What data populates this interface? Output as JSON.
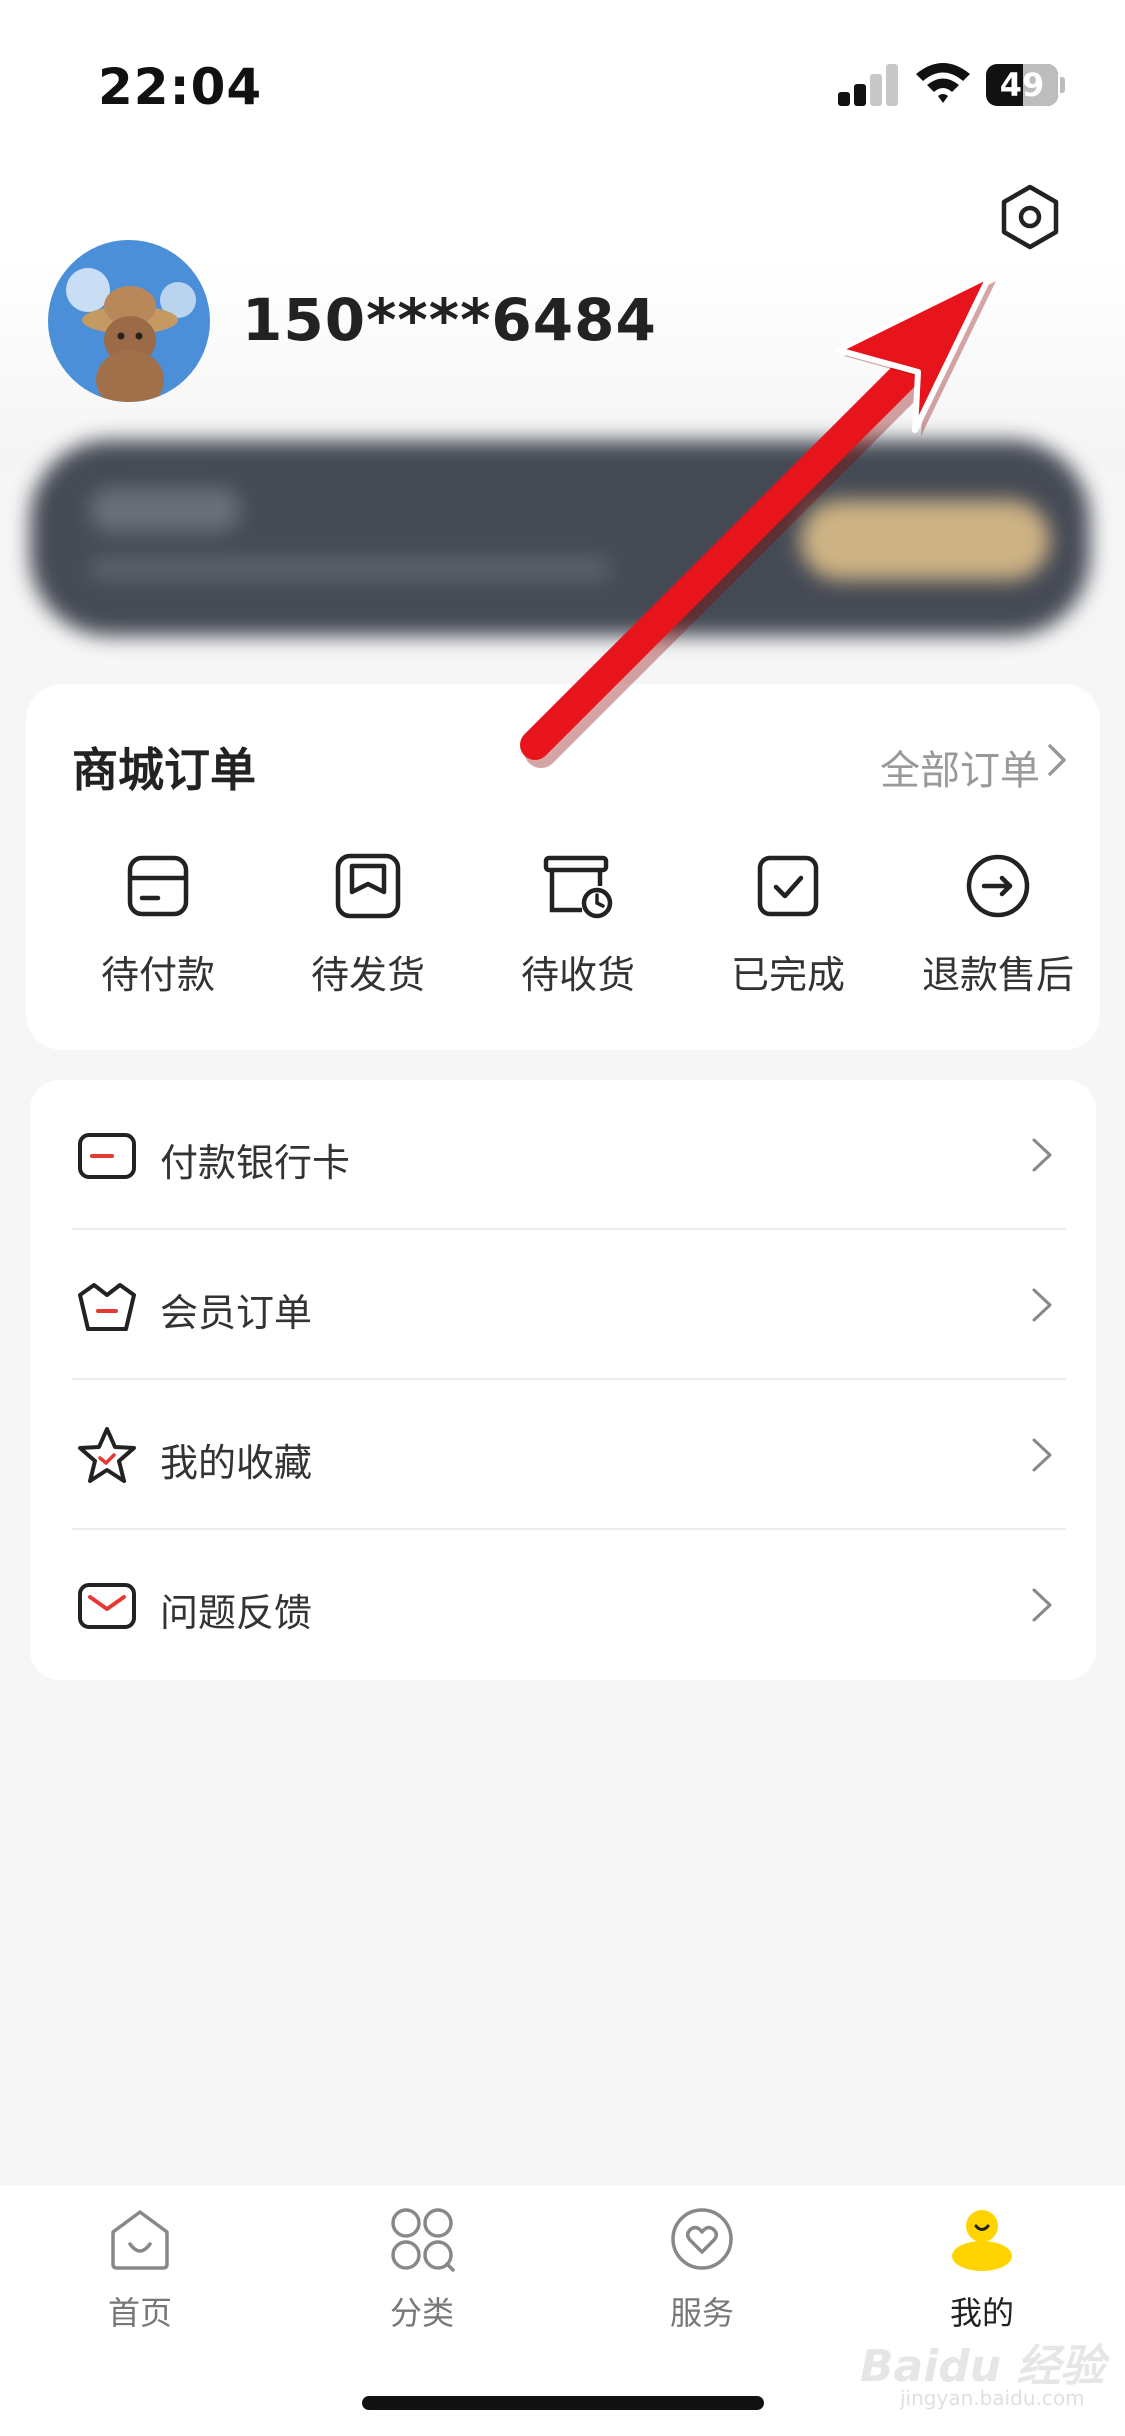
{
  "status_bar": {
    "time": "22:04",
    "battery": "49"
  },
  "profile": {
    "phone": "150****6484"
  },
  "orders": {
    "title": "商城订单",
    "all_link": "全部订单",
    "items": [
      {
        "label": "待付款",
        "icon": "wallet-icon"
      },
      {
        "label": "待发货",
        "icon": "package-icon"
      },
      {
        "label": "待收货",
        "icon": "delivery-icon"
      },
      {
        "label": "已完成",
        "icon": "check-box-icon"
      },
      {
        "label": "退款售后",
        "icon": "refund-icon"
      }
    ]
  },
  "menu": [
    {
      "label": "付款银行卡",
      "icon": "bank-card-icon"
    },
    {
      "label": "会员订单",
      "icon": "crown-icon"
    },
    {
      "label": "我的收藏",
      "icon": "star-icon"
    },
    {
      "label": "问题反馈",
      "icon": "mail-icon"
    }
  ],
  "tabs": [
    {
      "label": "首页",
      "icon": "home-icon"
    },
    {
      "label": "分类",
      "icon": "category-icon"
    },
    {
      "label": "服务",
      "icon": "service-heart-icon"
    },
    {
      "label": "我的",
      "icon": "profile-duck-icon"
    }
  ],
  "watermark": {
    "brand": "Baidu 经验",
    "url": "jingyan.baidu.com"
  },
  "colors": {
    "accent_red": "#e53935",
    "active_yellow": "#ffd400",
    "annotation_arrow": "#e8141c"
  }
}
